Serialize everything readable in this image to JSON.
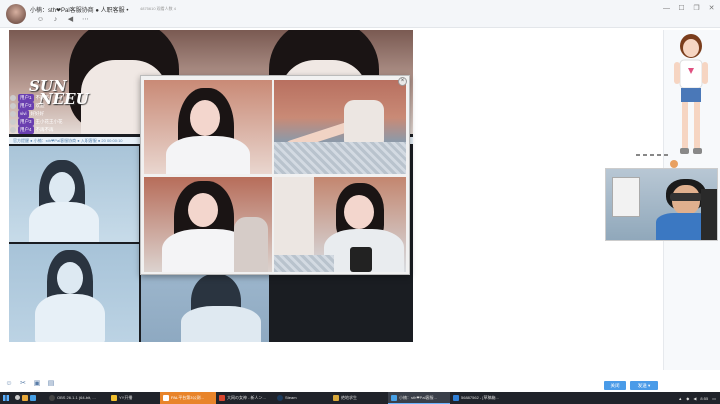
{
  "window": {
    "title": "小楠：sth❤Pal客服协商 ● 人职客服 •",
    "subtitle": "4875610  观看人数 4"
  },
  "title_icons": [
    "emoji-icon",
    "mic-icon",
    "speaker-icon",
    "more-icon"
  ],
  "window_controls": [
    "minimize-icon",
    "maximize-icon",
    "restore-icon",
    "close-icon"
  ],
  "stream": {
    "logo_line1": "SUN",
    "logo_line2": "NEEU",
    "chat": [
      {
        "name": "用户1",
        "text": "不期不"
      },
      {
        "name": "用户2",
        "text": "欢迎"
      },
      {
        "name": "vivi",
        "text": "好好好"
      },
      {
        "name": "用户3",
        "text": "王小花王小花"
      },
      {
        "name": "用户4",
        "text": "不再不再"
      }
    ],
    "notice": "官方提醒 ● 小楠：sth❤Pal客服协商 ● 入职客服 ● 20  00:00:10"
  },
  "popup": {
    "close": "×"
  },
  "bottom": {
    "tools": [
      "smile-icon",
      "scissors-icon",
      "image-icon",
      "folder-icon"
    ],
    "btn_close": "关闭",
    "btn_send": "发送"
  },
  "taskbar": {
    "items": [
      {
        "label": "",
        "style": "normal"
      },
      {
        "label": "OBS 26.1.1 (64-bit, ...",
        "style": "normal"
      },
      {
        "label": "YY开播",
        "style": "normal"
      },
      {
        "label": "PAL平台第3公测...",
        "style": "orange"
      },
      {
        "label": "大网の女神 - 新人ン...",
        "style": "normal"
      },
      {
        "label": "Steam",
        "style": "normal"
      },
      {
        "label": "绝地求生",
        "style": "normal"
      },
      {
        "label": "小楠：sth❤Pal客服...",
        "style": "active"
      },
      {
        "label": "56887562 - [草稿箱...",
        "style": "normal"
      }
    ],
    "clock": "8:55"
  }
}
